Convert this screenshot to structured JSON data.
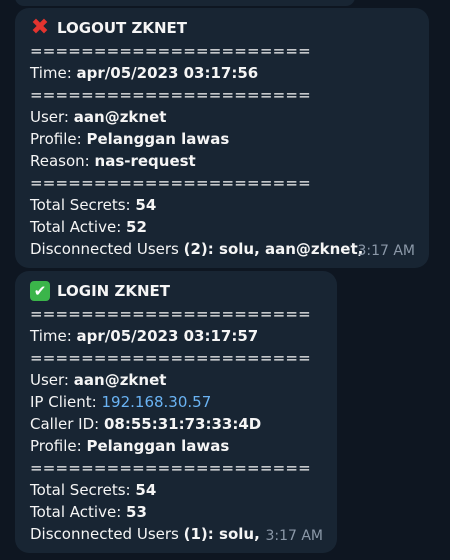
{
  "messages": [
    {
      "icon": "x-mark-icon",
      "icon_glyph": "✖",
      "title": "LOGOUT ZKNET",
      "separator": "======================",
      "time_label": "Time:",
      "time_value": "apr/05/2023 03:17:56",
      "user_label": "User:",
      "user_value": "aan@zknet",
      "profile_label": "Profile:",
      "profile_value": "Pelanggan lawas",
      "reason_label": "Reason:",
      "reason_value": "nas-request",
      "total_secrets_label": "Total Secrets:",
      "total_secrets_value": "54",
      "total_active_label": "Total Active:",
      "total_active_value": "52",
      "disconnected_label": "Disconnected Users",
      "disconnected_value": "(2): solu, aan@zknet,",
      "timestamp": "3:17 AM"
    },
    {
      "icon": "check-mark-icon",
      "icon_glyph": "✔",
      "title": "LOGIN ZKNET",
      "separator": "======================",
      "time_label": "Time:",
      "time_value": "apr/05/2023 03:17:57",
      "user_label": "User:",
      "user_value": "aan@zknet",
      "ip_label": "IP Client:",
      "ip_value": "192.168.30.57",
      "caller_label": "Caller ID:",
      "caller_value": "08:55:31:73:33:4D",
      "profile_label": "Profile:",
      "profile_value": "Pelanggan lawas",
      "total_secrets_label": "Total Secrets:",
      "total_secrets_value": "54",
      "total_active_label": "Total Active:",
      "total_active_value": "53",
      "disconnected_label": "Disconnected Users",
      "disconnected_value": "(1): solu,",
      "timestamp": "3:17 AM"
    }
  ],
  "colors": {
    "background": "#0e1621",
    "bubble": "#182533",
    "link": "#6ab3f3",
    "timestamp": "#8b98a8",
    "x_mark": "#e3342f",
    "check_bg": "#3bb54a"
  }
}
